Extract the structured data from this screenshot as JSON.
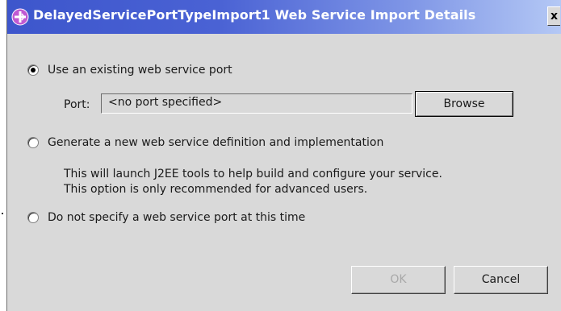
{
  "window": {
    "title": "DelayedServicePortTypeImport1 Web Service Import Details",
    "close_label": "x"
  },
  "options": {
    "use_existing_label": "Use an existing web service port",
    "generate_new_label": "Generate a new web service definition and implementation",
    "do_not_specify_label": "Do not specify a web service port at this time",
    "selected": "use_existing"
  },
  "port": {
    "label": "Port:",
    "value": "<no port specified>",
    "browse_label": "Browse"
  },
  "description": {
    "line1": "This will launch J2EE tools to help build and configure your service.",
    "line2": "This option is only recommended for advanced users."
  },
  "buttons": {
    "ok_label": "OK",
    "ok_enabled": false,
    "cancel_label": "Cancel"
  },
  "colors": {
    "title_gradient_start": "#3d56cc",
    "title_gradient_end": "#b4c8f5",
    "dialog_background": "#d9d9d9",
    "disabled_text": "#a8a8a8",
    "icon_color": "#b04fc2"
  },
  "icons": {
    "title_icon": "web-service-import-icon"
  }
}
